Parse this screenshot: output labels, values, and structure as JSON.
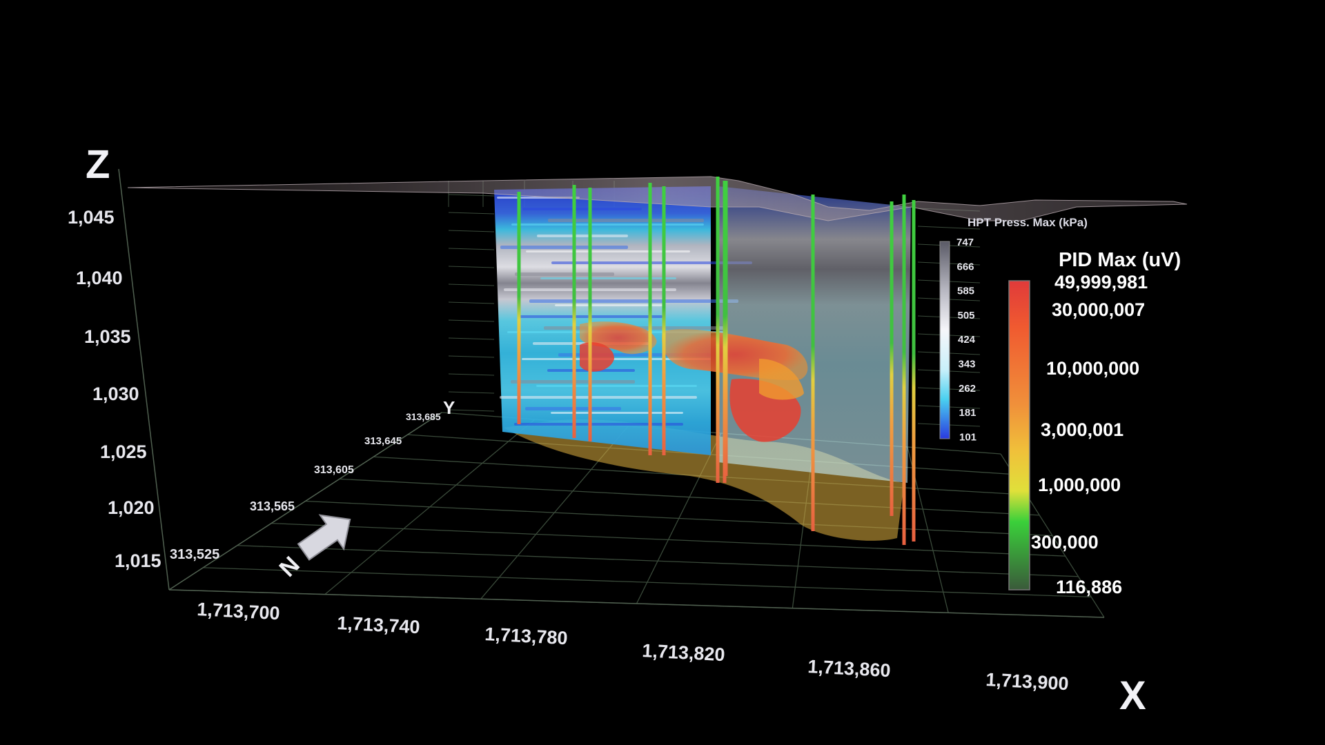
{
  "colors": {
    "background": "#000000",
    "grid": "#3a4a3a",
    "axis_text": "#e8e8ee",
    "plume_red": "#e8402a",
    "plume_orange": "#f0902a",
    "plume_yellow": "#e0c040"
  },
  "axes": {
    "z_letter": "Z",
    "y_letter": "Y",
    "x_letter": "X",
    "z_ticks": [
      "1,045",
      "1,040",
      "1,035",
      "1,030",
      "1,025",
      "1,020",
      "1,015"
    ],
    "y_ticks": [
      "313,685",
      "313,645",
      "313,605",
      "313,565",
      "313,525"
    ],
    "x_ticks": [
      "1,713,700",
      "1,713,740",
      "1,713,780",
      "1,713,820",
      "1,713,860",
      "1,713,900"
    ]
  },
  "north_arrow": {
    "label": "N",
    "icon": "north-arrow-icon"
  },
  "legend_hpt": {
    "title": "HPT Press. Max (kPa)",
    "values": [
      "747",
      "666",
      "585",
      "505",
      "424",
      "343",
      "262",
      "181",
      "101"
    ],
    "colors": [
      "#5a5a66",
      "#8a8a96",
      "#b8b8c2",
      "#e0e0e8",
      "#f6f6fa",
      "#c8f0fa",
      "#4ad0f0",
      "#3a7cf0",
      "#2a3ae0"
    ]
  },
  "legend_pid": {
    "title": "PID Max (uV)",
    "values": [
      "49,999,981",
      "30,000,007",
      "10,000,000",
      "3,000,001",
      "1,000,000",
      "300,000",
      "116,886"
    ],
    "colors": [
      "#e03a3a",
      "#f05a30",
      "#f0903a",
      "#f0c03a",
      "#e0e03a",
      "#3ad03a",
      "#3a5a3a"
    ]
  }
}
